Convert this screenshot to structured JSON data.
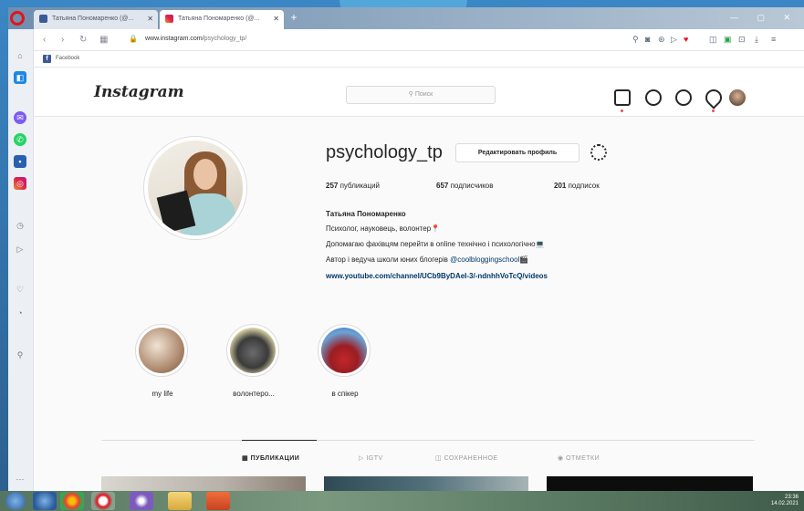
{
  "browser": {
    "tabs": [
      {
        "title": "Татьяна Пономаренко (@..."
      },
      {
        "title": "Татьяна Пономаренко (@..."
      }
    ],
    "new_tab": "+",
    "url_host": "www.instagram.com/",
    "url_path": "psychology_tp/",
    "bookmarks": [
      {
        "label": "Facebook"
      }
    ]
  },
  "instagram": {
    "logo": "Instagram",
    "search_placeholder": "Поиск",
    "nav_icons": [
      "home-icon",
      "messenger-icon",
      "explore-icon",
      "heart-icon",
      "profile-avatar"
    ]
  },
  "profile": {
    "username": "psychology_tp",
    "edit_button": "Редактировать профиль",
    "stats": {
      "posts_count": "257",
      "posts_label": "публикаций",
      "followers_count": "657",
      "followers_label": "подписчиков",
      "following_count": "201",
      "following_label": "подписок"
    },
    "full_name": "Татьяна Пономаренко",
    "bio_lines": [
      "Психолог, науковець, волонтер📍",
      "Допомагаю фахівцям перейти в online технічно і психологічно💻",
      "Автор і ведуча школи юних блогерів "
    ],
    "bio_mention": "@coolbloggingschool",
    "bio_mention_suffix": "🎬",
    "link": "www.youtube.com/channel/UCb9ByDAeI-3/-ndnhhVoTcQ/videos"
  },
  "highlights": [
    {
      "label": "my life"
    },
    {
      "label": "волонтеро..."
    },
    {
      "label": "в спікер"
    }
  ],
  "profile_tabs": [
    {
      "label": "ПУБЛИКАЦИИ",
      "icon": "grid-icon",
      "active": true
    },
    {
      "label": "IGTV",
      "icon": "igtv-icon",
      "active": false
    },
    {
      "label": "СОХРАНЕННОЕ",
      "icon": "bookmark-icon",
      "active": false
    },
    {
      "label": "ОТМЕТКИ",
      "icon": "tag-icon",
      "active": false
    }
  ],
  "taskbar": {
    "time": "23:36",
    "date": "14.02.2021"
  },
  "colors": {
    "opera_red": "#e0141e",
    "link_blue": "#00376b",
    "ig_text": "#262626",
    "notification_red": "#ed4956"
  }
}
